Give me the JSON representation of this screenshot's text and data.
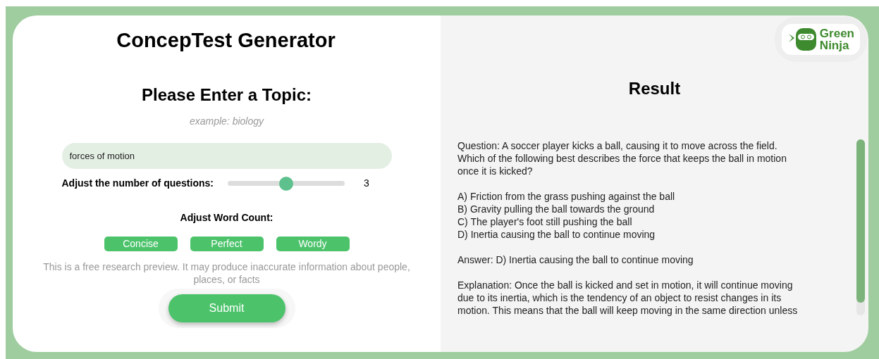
{
  "left": {
    "title": "ConcepTest Generator",
    "topic_heading": "Please Enter a Topic:",
    "topic_hint": "example: biology",
    "topic_field": {
      "value": "forces of motion"
    },
    "questions_slider": {
      "label": "Adjust the number of questions:",
      "level": 0.5,
      "reading": "3"
    },
    "word_count": {
      "label": "Adjust Word Count:",
      "options": [
        "Concise",
        "Perfect",
        "Wordy"
      ]
    },
    "disclaimer": "This is a free research preview. It may produce inaccurate information about people, places, or facts",
    "submit": "Submit"
  },
  "right": {
    "logo": {
      "line_1": "Green",
      "line_2": "Ninja"
    },
    "title": "Result",
    "paragraphs": [
      [
        "Question: A soccer player kicks a ball, causing it to move across the field.",
        "Which of the following best describes the force that keeps the ball in motion",
        "once it is kicked?"
      ],
      [
        "A) Friction from the grass pushing against the ball",
        "B) Gravity pulling the ball towards the ground",
        "C) The player's foot still pushing the ball",
        "D) Inertia causing the ball to continue moving"
      ],
      [
        "Answer: D) Inertia causing the ball to continue moving"
      ],
      [
        "Explanation: Once the ball is kicked and set in motion, it will continue moving",
        "due to its inertia, which is the tendency of an object to resist changes in its",
        "motion. This means that the ball will keep moving in the same direction unless"
      ]
    ]
  }
}
